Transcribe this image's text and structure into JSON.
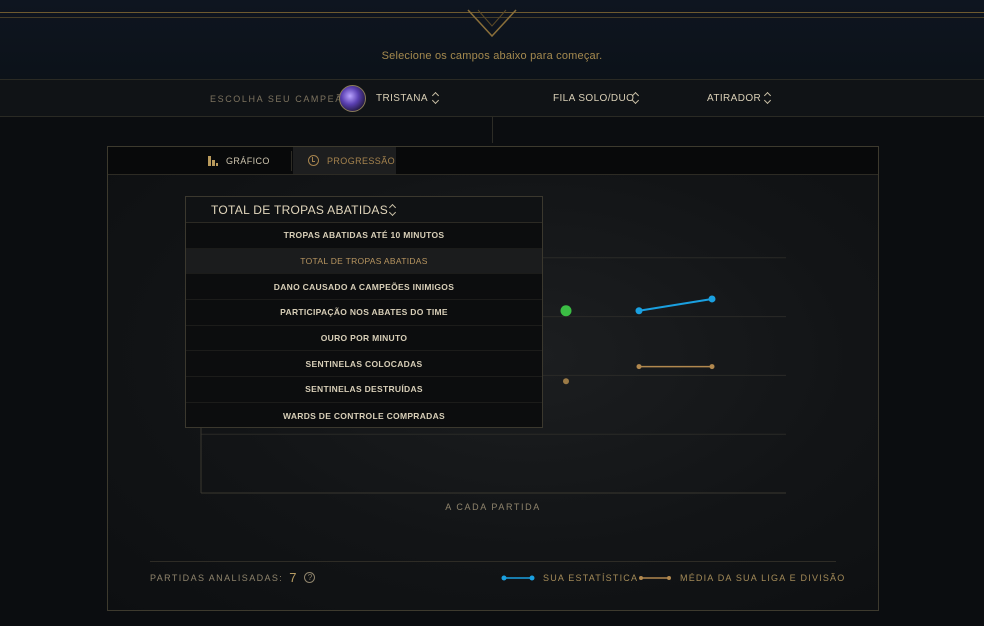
{
  "header": {
    "prompt": "Selecione os campos abaixo para começar."
  },
  "selectors": {
    "champion_label": "ESCOLHA SEU CAMPEÃO:",
    "champion": "TRISTANA",
    "queue": "FILA SOLO/DUO",
    "role": "ATIRADOR"
  },
  "tabs": [
    {
      "label": "GRÁFICO",
      "icon": "bar-chart-icon",
      "active": false
    },
    {
      "label": "PROGRESSÃO",
      "icon": "clock-icon",
      "active": true
    }
  ],
  "metric_dropdown": {
    "selected": "TOTAL DE TROPAS ABATIDAS",
    "options": [
      "TROPAS ABATIDAS ATÉ 10 MINUTOS",
      "TOTAL DE TROPAS ABATIDAS",
      "DANO CAUSADO A CAMPEÕES INIMIGOS",
      "PARTICIPAÇÃO NOS ABATES DO TIME",
      "OURO POR MINUTO",
      "SENTINELAS COLOCADAS",
      "SENTINELAS DESTRUÍDAS",
      "WARDS DE CONTROLE COMPRADAS"
    ]
  },
  "chart_data": {
    "type": "line",
    "xlabel": "A CADA PARTIDA",
    "x": [
      1,
      2,
      3
    ],
    "series": [
      {
        "name": "SUA ESTATÍSTICA",
        "color": "#1aa0e0",
        "values": [
          null,
          0.62,
          0.66
        ]
      },
      {
        "name": "MÉDIA DA SUA LIGA E DIVISÃO",
        "color": "#b1884e",
        "values": [
          null,
          0.43,
          0.43
        ]
      }
    ],
    "extra_points": [
      {
        "x": 1,
        "y": 0.62,
        "color": "#3bbd44"
      },
      {
        "x": 1,
        "y": 0.38,
        "color": "#9b7a46"
      }
    ],
    "ylim": [
      0,
      1
    ],
    "grid": true
  },
  "footer": {
    "analyzed_label": "PARTIDAS ANALISADAS:",
    "analyzed_count": "7",
    "help": "?"
  },
  "legend": {
    "mine": "SUA ESTATÍSTICA",
    "avg": "MÉDIA DA SUA LIGA E DIVISÃO"
  },
  "colors": {
    "gold": "#b1884e",
    "blue": "#1aa0e0",
    "green": "#3bbd44"
  }
}
